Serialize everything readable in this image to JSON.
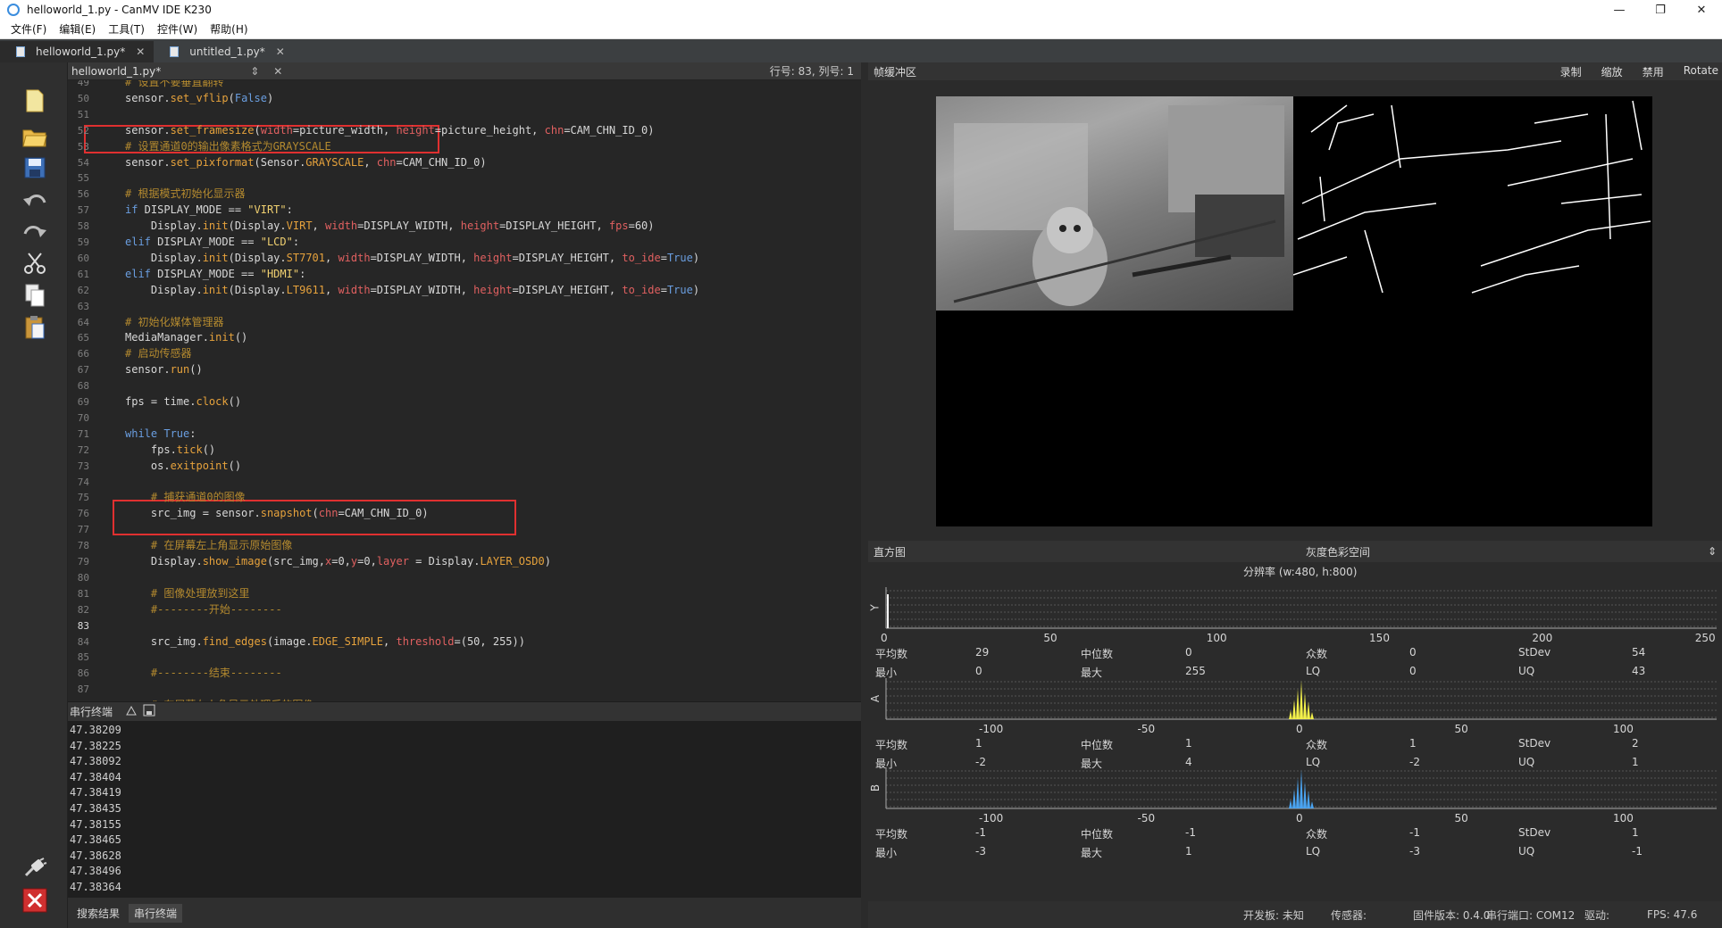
{
  "window": {
    "title": "helloworld_1.py - CanMV IDE K230",
    "minimize": "—",
    "maximize": "❐",
    "close": "✕"
  },
  "menu": [
    "文件(F)",
    "编辑(E)",
    "工具(T)",
    "控件(W)",
    "帮助(H)"
  ],
  "tabs": [
    {
      "label": "helloworld_1.py*",
      "close": "✕"
    },
    {
      "label": "untitled_1.py*",
      "close": "✕"
    }
  ],
  "editor": {
    "file": "helloworld_1.py*",
    "updown": "⇕",
    "close": "✕",
    "position": "行号: 83, 列号: 1",
    "lines": [
      {
        "n": "49",
        "t": "    # 设置不要垂直翻转"
      },
      {
        "n": "50",
        "t": "    sensor.set_vflip(False)"
      },
      {
        "n": "51",
        "t": ""
      },
      {
        "n": "52",
        "t": "    sensor.set_framesize(width=picture_width, height=picture_height, chn=CAM_CHN_ID_0)"
      },
      {
        "n": "53",
        "t": "    # 设置通道0的输出像素格式为GRAYSCALE"
      },
      {
        "n": "54",
        "t": "    sensor.set_pixformat(Sensor.GRAYSCALE, chn=CAM_CHN_ID_0)"
      },
      {
        "n": "55",
        "t": ""
      },
      {
        "n": "56",
        "t": "    # 根据模式初始化显示器"
      },
      {
        "n": "57",
        "t": "    if DISPLAY_MODE == \"VIRT\":"
      },
      {
        "n": "58",
        "t": "        Display.init(Display.VIRT, width=DISPLAY_WIDTH, height=DISPLAY_HEIGHT, fps=60)"
      },
      {
        "n": "59",
        "t": "    elif DISPLAY_MODE == \"LCD\":"
      },
      {
        "n": "60",
        "t": "        Display.init(Display.ST7701, width=DISPLAY_WIDTH, height=DISPLAY_HEIGHT, to_ide=True)"
      },
      {
        "n": "61",
        "t": "    elif DISPLAY_MODE == \"HDMI\":"
      },
      {
        "n": "62",
        "t": "        Display.init(Display.LT9611, width=DISPLAY_WIDTH, height=DISPLAY_HEIGHT, to_ide=True)"
      },
      {
        "n": "63",
        "t": ""
      },
      {
        "n": "64",
        "t": "    # 初始化媒体管理器"
      },
      {
        "n": "65",
        "t": "    MediaManager.init()"
      },
      {
        "n": "66",
        "t": "    # 启动传感器"
      },
      {
        "n": "67",
        "t": "    sensor.run()"
      },
      {
        "n": "68",
        "t": ""
      },
      {
        "n": "69",
        "t": "    fps = time.clock()"
      },
      {
        "n": "70",
        "t": ""
      },
      {
        "n": "71",
        "t": "    while True:"
      },
      {
        "n": "72",
        "t": "        fps.tick()"
      },
      {
        "n": "73",
        "t": "        os.exitpoint()"
      },
      {
        "n": "74",
        "t": ""
      },
      {
        "n": "75",
        "t": "        # 捕获通道0的图像"
      },
      {
        "n": "76",
        "t": "        src_img = sensor.snapshot(chn=CAM_CHN_ID_0)"
      },
      {
        "n": "77",
        "t": ""
      },
      {
        "n": "78",
        "t": "        # 在屏幕左上角显示原始图像"
      },
      {
        "n": "79",
        "t": "        Display.show_image(src_img,x=0,y=0,layer = Display.LAYER_OSD0)"
      },
      {
        "n": "80",
        "t": ""
      },
      {
        "n": "81",
        "t": "        # 图像处理放到这里"
      },
      {
        "n": "82",
        "t": "        #--------开始--------"
      },
      {
        "n": "83",
        "t": ""
      },
      {
        "n": "84",
        "t": "        src_img.find_edges(image.EDGE_SIMPLE, threshold=(50, 255))"
      },
      {
        "n": "85",
        "t": ""
      },
      {
        "n": "86",
        "t": "        #--------结束--------"
      },
      {
        "n": "87",
        "t": ""
      },
      {
        "n": "88",
        "t": "        # 在屏幕左上角显示处理后的图像"
      }
    ]
  },
  "terminal": {
    "title": "串行终端",
    "lines": [
      "47.38209",
      "47.38225",
      "47.38092",
      "47.38404",
      "47.38419",
      "47.38435",
      "47.38155",
      "47.38465",
      "47.38628",
      "47.38496",
      "47.38364"
    ]
  },
  "bottom_tabs": [
    "搜索结果",
    "串行终端"
  ],
  "framebuffer": {
    "title": "帧缓冲区",
    "actions": [
      "录制",
      "缩放",
      "禁用",
      "Rotate"
    ]
  },
  "histogram": {
    "title": "直方图",
    "colorspace": "灰度色彩空间",
    "resolution": "分辨率 (w:480, h:800)",
    "channels": [
      {
        "axis": "Y",
        "ticks": [
          "0",
          "50",
          "100",
          "150",
          "200",
          "250"
        ],
        "stats": [
          [
            "平均数",
            "29",
            "中位数",
            "0",
            "众数",
            "0",
            "StDev",
            "54"
          ],
          [
            "最小",
            "0",
            "最大",
            "255",
            "LQ",
            "0",
            "UQ",
            "43"
          ]
        ]
      },
      {
        "axis": "A",
        "ticks": [
          "-100",
          "-50",
          "0",
          "50",
          "100"
        ],
        "stats": [
          [
            "平均数",
            "1",
            "中位数",
            "1",
            "众数",
            "1",
            "StDev",
            "2"
          ],
          [
            "最小",
            "-2",
            "最大",
            "4",
            "LQ",
            "-2",
            "UQ",
            "1"
          ]
        ]
      },
      {
        "axis": "B",
        "ticks": [
          "-100",
          "-50",
          "0",
          "50",
          "100"
        ],
        "stats": [
          [
            "平均数",
            "-1",
            "中位数",
            "-1",
            "众数",
            "-1",
            "StDev",
            "1"
          ],
          [
            "最小",
            "-3",
            "最大",
            "1",
            "LQ",
            "-3",
            "UQ",
            "-1"
          ]
        ]
      }
    ]
  },
  "status": {
    "board": "开发板: 未知",
    "sensor": "传感器:",
    "firmware": "固件版本: 0.4.0",
    "port": "串行端口: COM12",
    "driver": "驱动:",
    "fps": "FPS: 47.6"
  },
  "colors": {
    "keyword": "#6a9ee0",
    "function": "#e6a23c",
    "param": "#e06060",
    "string": "#f0d070",
    "comment": "#b48a2f",
    "highlight": "#e03030",
    "hist_y": "#ffffff",
    "hist_a": "#f2f04a",
    "hist_b": "#4aa3f0"
  }
}
